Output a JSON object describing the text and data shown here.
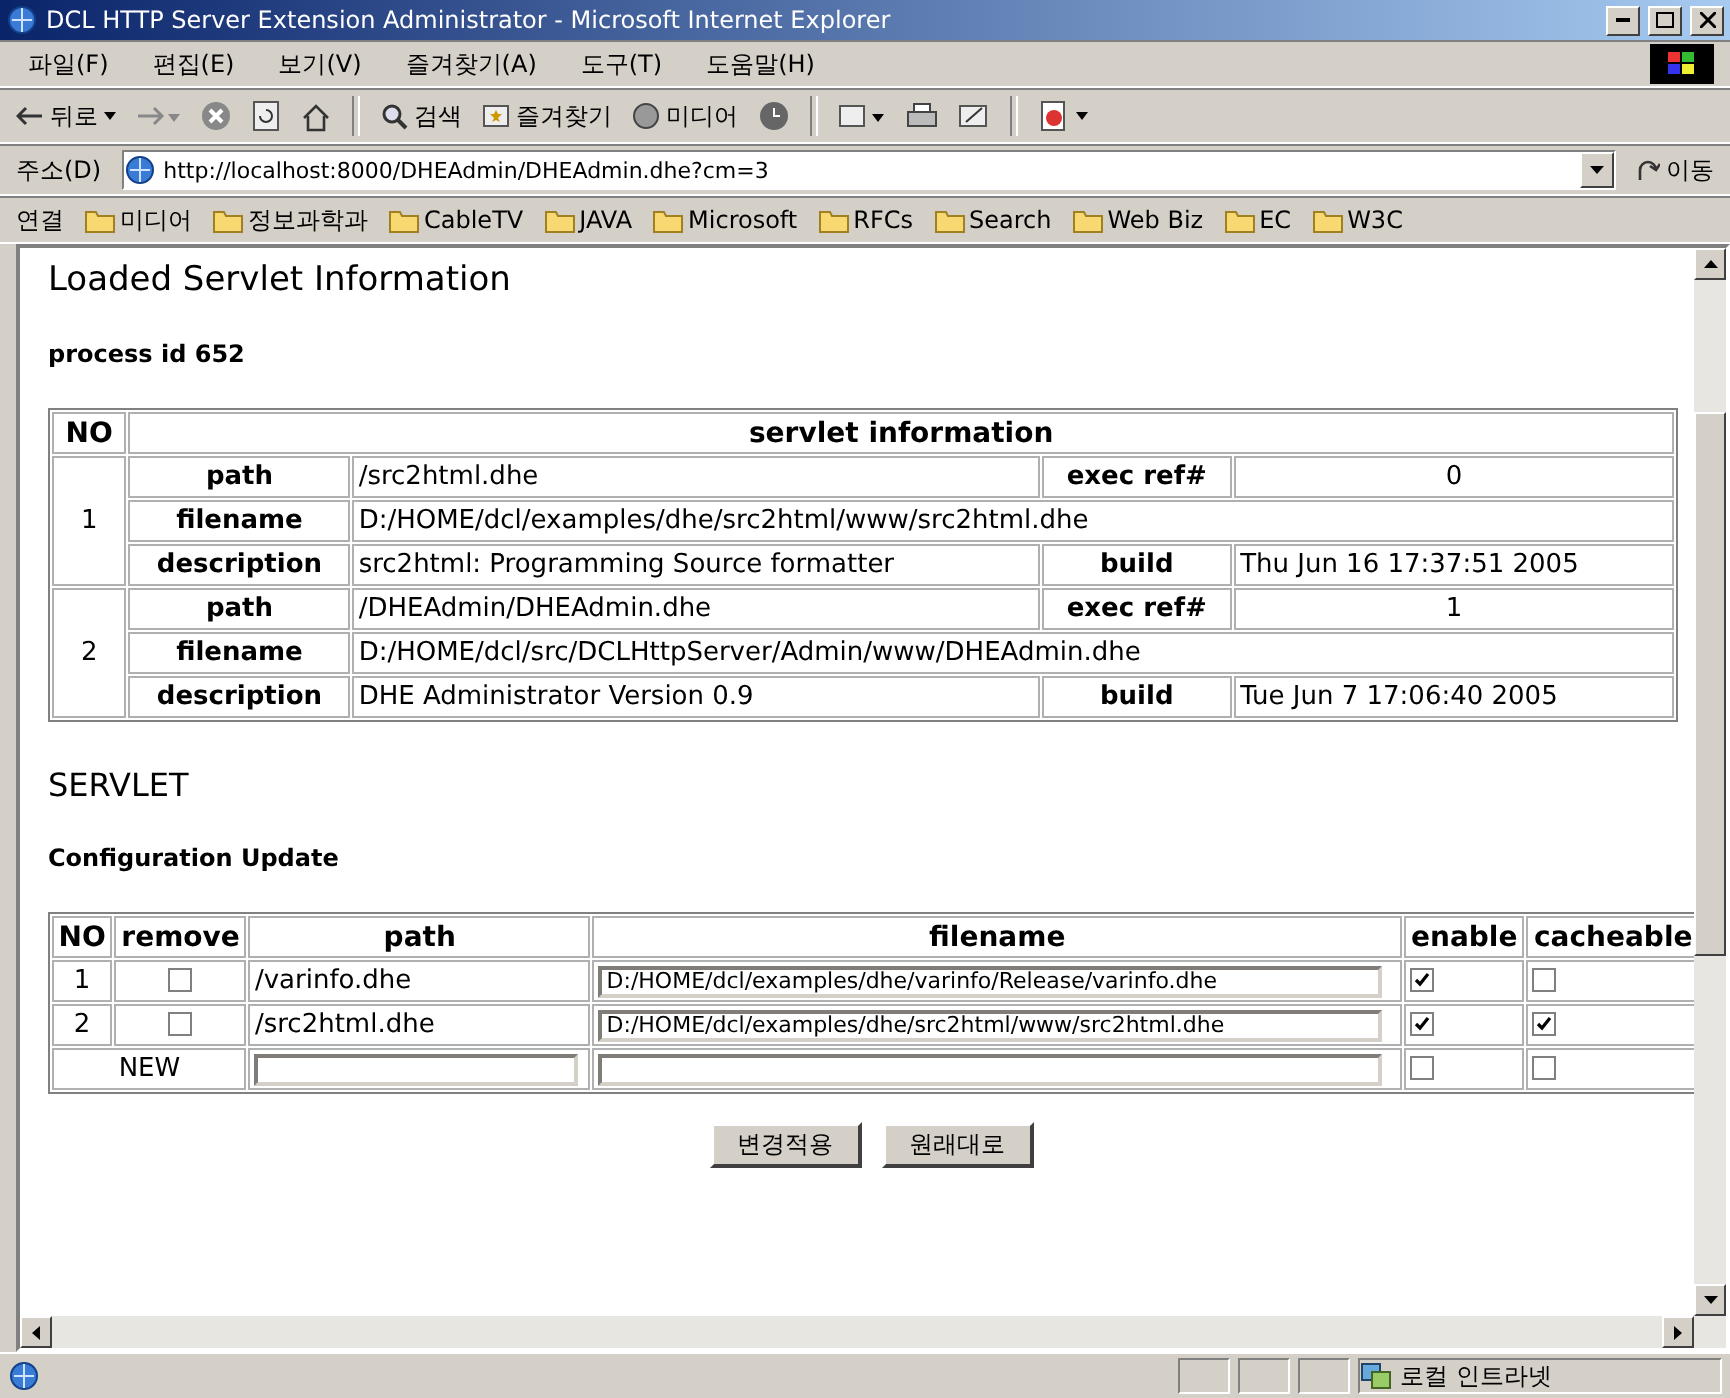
{
  "window": {
    "title": "DCL HTTP Server Extension Administrator - Microsoft Internet Explorer"
  },
  "menu": [
    "파일(F)",
    "편집(E)",
    "보기(V)",
    "즐겨찾기(A)",
    "도구(T)",
    "도움말(H)"
  ],
  "toolbar": {
    "back": "뒤로",
    "search": "검색",
    "favorites": "즐겨찾기",
    "media": "미디어"
  },
  "address": {
    "label": "주소(D)",
    "url": "http://localhost:8000/DHEAdmin/DHEAdmin.dhe?cm=3",
    "go": "이동"
  },
  "links": {
    "label": "연결",
    "items": [
      "미디어",
      "정보과학과",
      "CableTV",
      "JAVA",
      "Microsoft",
      "RFCs",
      "Search",
      "Web Biz",
      "EC",
      "W3C"
    ]
  },
  "page": {
    "heading": "Loaded Servlet Information",
    "process": "process id 652",
    "info_table": {
      "columns": [
        "NO",
        "servlet information"
      ],
      "servlets": [
        {
          "no": "1",
          "rows": [
            {
              "label": "path",
              "value": "/src2html.dhe",
              "label2": "exec ref#",
              "value2": "0"
            },
            {
              "label": "filename",
              "value": "D:/HOME/dcl/examples/dhe/src2html/www/src2html.dhe"
            },
            {
              "label": "description",
              "value": "src2html: Programming Source formatter",
              "label2": "build",
              "value2": "Thu Jun 16 17:37:51 2005"
            }
          ]
        },
        {
          "no": "2",
          "rows": [
            {
              "label": "path",
              "value": "/DHEAdmin/DHEAdmin.dhe",
              "label2": "exec ref#",
              "value2": "1"
            },
            {
              "label": "filename",
              "value": "D:/HOME/dcl/src/DCLHttpServer/Admin/www/DHEAdmin.dhe"
            },
            {
              "label": "description",
              "value": "DHE Administrator Version 0.9",
              "label2": "build",
              "value2": "Tue Jun 7 17:06:40 2005"
            }
          ]
        }
      ]
    },
    "section": "SERVLET",
    "subheading": "Configuration Update",
    "config_table": {
      "columns": [
        "NO",
        "remove",
        "path",
        "filename",
        "enable",
        "cacheable"
      ],
      "rows": [
        {
          "no": "1",
          "remove": false,
          "path": "/varinfo.dhe",
          "filename": "D:/HOME/dcl/examples/dhe/varinfo/Release/varinfo.dhe",
          "enable": true,
          "cacheable": false
        },
        {
          "no": "2",
          "remove": false,
          "path": "/src2html.dhe",
          "filename": "D:/HOME/dcl/examples/dhe/src2html/www/src2html.dhe",
          "enable": true,
          "cacheable": true
        }
      ],
      "new_row": {
        "label": "NEW",
        "enable": false,
        "cacheable": false
      }
    },
    "buttons": [
      "변경적용",
      "원래대로"
    ]
  },
  "status_bar": {
    "zone": "로컬 인트라넷"
  }
}
